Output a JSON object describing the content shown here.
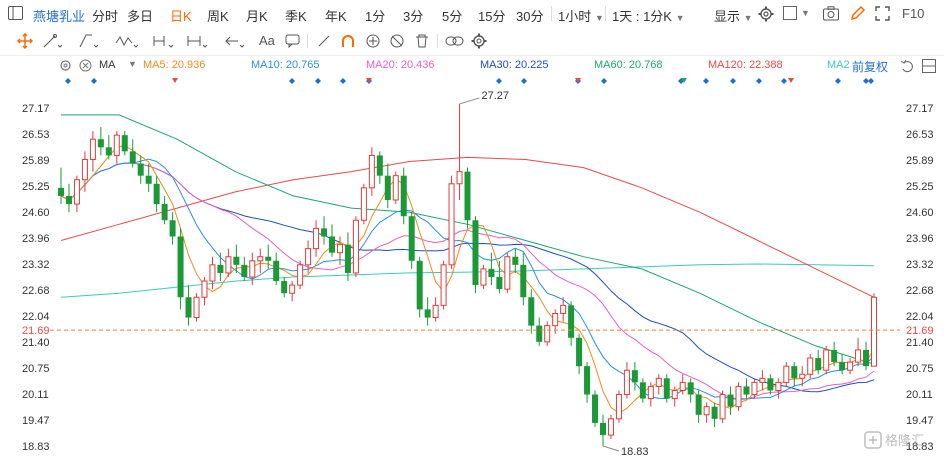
{
  "header": {
    "stock_name": "燕塘乳业",
    "periods": [
      "分时",
      "多日",
      "日K",
      "周K",
      "月K",
      "季K",
      "年K",
      "1分",
      "3分",
      "5分",
      "15分",
      "30分"
    ],
    "active_period": "日K",
    "dropdown_1": "1小时",
    "dropdown_2": "1天 : 1分K",
    "display_label": "显示",
    "f10_label": "F10"
  },
  "toolbar": {
    "text_tool": "Aa"
  },
  "indicators": {
    "ma_label": "MA",
    "ma5": "MA5: 20.936",
    "ma10": "MA10: 20.765",
    "ma20": "MA20: 20.436",
    "ma30": "MA30: 20.225",
    "ma60": "MA60: 20.768",
    "ma120": "MA120: 22.388",
    "ma_truncated": "MA2",
    "adjust_mode": "前复权"
  },
  "colors": {
    "up": "#e23b3b",
    "down": "#1a9a36",
    "ma5": "#f08a1c",
    "ma10": "#2a8fe0",
    "ma20": "#e85fc7",
    "ma30": "#1f4fb5",
    "ma60": "#1aa66e",
    "ma120": "#e84a4a",
    "ma_long": "#3ec9c2",
    "price_line": "#e0883a",
    "accent": "#1f6fd9",
    "active": "#ff6a00"
  },
  "chart_data": {
    "type": "candlestick",
    "y_ticks": [
      "27.17",
      "26.53",
      "25.89",
      "25.25",
      "24.60",
      "23.96",
      "23.32",
      "22.68",
      "22.04",
      "21.40",
      "20.75",
      "20.11",
      "19.47",
      "18.83"
    ],
    "ylim": [
      18.83,
      27.17
    ],
    "current_price": "21.69",
    "high_label": "27.27",
    "low_label": "18.83",
    "candles": [
      [
        25.2,
        25.7,
        24.8,
        25.0
      ],
      [
        25.0,
        25.3,
        24.6,
        24.8
      ],
      [
        24.8,
        25.5,
        24.6,
        25.4
      ],
      [
        25.4,
        26.1,
        25.1,
        25.9
      ],
      [
        25.9,
        26.6,
        25.6,
        26.4
      ],
      [
        26.4,
        26.7,
        26.0,
        26.2
      ],
      [
        26.2,
        26.5,
        25.9,
        26.0
      ],
      [
        26.0,
        26.6,
        25.8,
        26.5
      ],
      [
        26.5,
        26.6,
        26.0,
        26.1
      ],
      [
        26.1,
        26.4,
        25.7,
        25.8
      ],
      [
        25.8,
        26.0,
        25.3,
        25.5
      ],
      [
        25.5,
        25.8,
        25.1,
        25.3
      ],
      [
        25.3,
        25.5,
        24.6,
        24.8
      ],
      [
        24.8,
        25.0,
        24.3,
        24.4
      ],
      [
        24.4,
        24.6,
        23.8,
        24.0
      ],
      [
        24.0,
        24.2,
        22.2,
        22.5
      ],
      [
        22.5,
        22.8,
        21.8,
        22.0
      ],
      [
        22.0,
        22.6,
        21.9,
        22.5
      ],
      [
        22.5,
        23.0,
        22.3,
        22.9
      ],
      [
        22.9,
        23.5,
        22.7,
        23.3
      ],
      [
        23.3,
        23.6,
        22.9,
        23.1
      ],
      [
        23.1,
        23.7,
        23.0,
        23.5
      ],
      [
        23.5,
        23.8,
        23.1,
        23.3
      ],
      [
        23.3,
        23.5,
        22.9,
        23.0
      ],
      [
        23.0,
        23.6,
        22.8,
        23.4
      ],
      [
        23.4,
        23.7,
        23.1,
        23.5
      ],
      [
        23.5,
        23.8,
        23.2,
        23.4
      ],
      [
        23.4,
        23.6,
        22.8,
        22.9
      ],
      [
        22.9,
        23.0,
        22.5,
        22.6
      ],
      [
        22.6,
        22.9,
        22.4,
        22.8
      ],
      [
        22.8,
        23.4,
        22.7,
        23.3
      ],
      [
        23.3,
        23.9,
        23.1,
        23.7
      ],
      [
        23.7,
        24.4,
        23.5,
        24.2
      ],
      [
        24.2,
        24.5,
        23.8,
        24.0
      ],
      [
        24.0,
        24.3,
        23.5,
        23.6
      ],
      [
        23.6,
        24.0,
        23.3,
        23.8
      ],
      [
        23.8,
        24.1,
        22.9,
        23.1
      ],
      [
        23.1,
        24.5,
        23.0,
        24.4
      ],
      [
        24.4,
        25.3,
        24.3,
        25.2
      ],
      [
        25.2,
        26.2,
        25.0,
        26.0
      ],
      [
        26.0,
        26.1,
        25.3,
        25.5
      ],
      [
        25.5,
        25.8,
        24.7,
        24.9
      ],
      [
        24.9,
        25.6,
        24.8,
        25.5
      ],
      [
        25.5,
        25.7,
        24.3,
        24.5
      ],
      [
        24.5,
        24.6,
        23.2,
        23.4
      ],
      [
        23.4,
        23.5,
        22.0,
        22.2
      ],
      [
        22.2,
        22.5,
        21.8,
        22.0
      ],
      [
        22.0,
        22.5,
        21.9,
        22.3
      ],
      [
        22.3,
        23.4,
        22.2,
        23.3
      ],
      [
        23.3,
        25.5,
        23.2,
        25.3
      ],
      [
        25.3,
        27.27,
        24.9,
        25.6
      ],
      [
        25.6,
        25.7,
        24.2,
        24.4
      ],
      [
        24.4,
        24.5,
        22.6,
        22.8
      ],
      [
        22.8,
        23.3,
        22.7,
        23.2
      ],
      [
        23.2,
        23.6,
        22.8,
        23.0
      ],
      [
        23.0,
        23.4,
        22.6,
        22.7
      ],
      [
        22.7,
        23.6,
        22.6,
        23.5
      ],
      [
        23.5,
        23.7,
        23.1,
        23.3
      ],
      [
        23.3,
        23.6,
        22.3,
        22.5
      ],
      [
        22.5,
        22.7,
        21.6,
        21.8
      ],
      [
        21.8,
        22.0,
        21.3,
        21.4
      ],
      [
        21.4,
        21.9,
        21.3,
        21.8
      ],
      [
        21.8,
        22.2,
        21.6,
        22.1
      ],
      [
        22.1,
        22.5,
        21.9,
        22.3
      ],
      [
        22.3,
        22.4,
        21.3,
        21.5
      ],
      [
        21.5,
        21.6,
        20.6,
        20.8
      ],
      [
        20.8,
        20.9,
        19.9,
        20.1
      ],
      [
        20.1,
        20.2,
        19.3,
        19.4
      ],
      [
        19.4,
        19.6,
        18.83,
        19.1
      ],
      [
        19.1,
        19.6,
        19.0,
        19.5
      ],
      [
        19.5,
        20.2,
        19.4,
        20.1
      ],
      [
        20.1,
        20.9,
        20.0,
        20.7
      ],
      [
        20.7,
        20.9,
        20.2,
        20.4
      ],
      [
        20.4,
        20.5,
        19.9,
        20.0
      ],
      [
        20.0,
        20.4,
        19.8,
        20.3
      ],
      [
        20.3,
        20.6,
        20.1,
        20.5
      ],
      [
        20.5,
        20.6,
        19.9,
        20.0
      ],
      [
        20.0,
        20.3,
        19.8,
        20.2
      ],
      [
        20.2,
        20.6,
        20.1,
        20.4
      ],
      [
        20.4,
        20.5,
        19.9,
        20.1
      ],
      [
        20.1,
        20.2,
        19.4,
        19.6
      ],
      [
        19.6,
        19.9,
        19.4,
        19.8
      ],
      [
        19.8,
        19.9,
        19.3,
        19.5
      ],
      [
        19.5,
        20.2,
        19.4,
        20.1
      ],
      [
        20.1,
        20.3,
        19.6,
        19.8
      ],
      [
        19.8,
        20.4,
        19.7,
        20.3
      ],
      [
        20.3,
        20.5,
        20.0,
        20.1
      ],
      [
        20.1,
        20.5,
        20.0,
        20.4
      ],
      [
        20.4,
        20.7,
        20.2,
        20.5
      ],
      [
        20.5,
        20.6,
        20.1,
        20.2
      ],
      [
        20.2,
        20.5,
        20.0,
        20.4
      ],
      [
        20.4,
        20.9,
        20.3,
        20.8
      ],
      [
        20.8,
        20.9,
        20.3,
        20.5
      ],
      [
        20.5,
        20.8,
        20.3,
        20.6
      ],
      [
        20.6,
        21.1,
        20.5,
        21.0
      ],
      [
        21.0,
        21.2,
        20.6,
        20.7
      ],
      [
        20.7,
        21.3,
        20.6,
        21.2
      ],
      [
        21.2,
        21.4,
        20.8,
        20.9
      ],
      [
        20.9,
        21.1,
        20.6,
        20.7
      ],
      [
        20.7,
        21.0,
        20.6,
        20.9
      ],
      [
        20.9,
        21.5,
        20.8,
        21.2
      ],
      [
        21.2,
        21.4,
        20.7,
        20.8
      ],
      [
        20.8,
        22.6,
        20.8,
        22.5
      ]
    ]
  }
}
